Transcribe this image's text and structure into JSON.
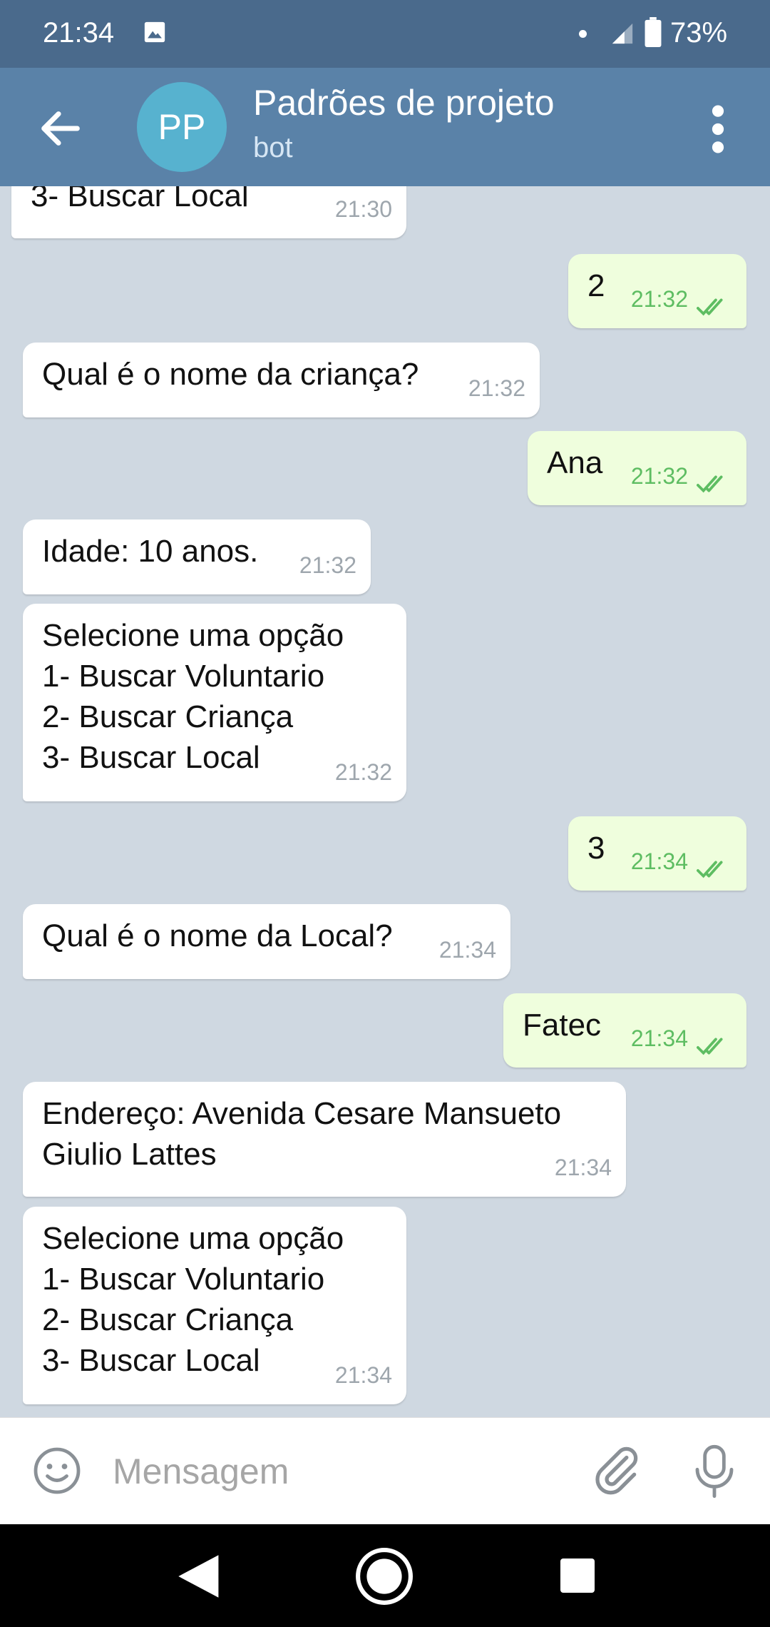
{
  "status_bar": {
    "time": "21:34",
    "battery": "73%"
  },
  "header": {
    "avatar_initials": "PP",
    "title": "Padrões de projeto",
    "subtitle": "bot"
  },
  "messages": [
    {
      "direction": "in",
      "text": "3- Buscar Local",
      "time": "21:30"
    },
    {
      "direction": "out",
      "text": "2",
      "time": "21:32"
    },
    {
      "direction": "in",
      "text": "Qual é o nome da criança?",
      "time": "21:32"
    },
    {
      "direction": "out",
      "text": "Ana",
      "time": "21:32"
    },
    {
      "direction": "in",
      "text": "Idade: 10 anos.",
      "time": "21:32"
    },
    {
      "direction": "in",
      "text": "Selecione uma opção\n1- Buscar Voluntario\n2- Buscar Criança\n3- Buscar Local",
      "time": "21:32"
    },
    {
      "direction": "out",
      "text": "3",
      "time": "21:34"
    },
    {
      "direction": "in",
      "text": "Qual é o nome da Local?",
      "time": "21:34"
    },
    {
      "direction": "out",
      "text": "Fatec",
      "time": "21:34"
    },
    {
      "direction": "in",
      "text": "Endereço: Avenida Cesare Mansueto\nGiulio Lattes",
      "time": "21:34"
    },
    {
      "direction": "in",
      "text": "Selecione uma opção\n1- Buscar Voluntario\n2- Buscar Criança\n3- Buscar Local",
      "time": "21:34"
    }
  ],
  "composer": {
    "placeholder": "Mensagem"
  },
  "icons": {
    "back": "arrow-left-icon",
    "menu": "more-vert-icon",
    "emoji": "smile-icon",
    "attach": "paperclip-icon",
    "mic": "microphone-icon",
    "read": "double-check-icon"
  },
  "colors": {
    "status_bar": "#4a6a8c",
    "app_bar": "#5a82a8",
    "avatar": "#57b2cf",
    "chat_background": "#cfd8e1",
    "incoming_bubble": "#ffffff",
    "outgoing_bubble": "#effedd",
    "outgoing_time": "#5ebd62"
  }
}
